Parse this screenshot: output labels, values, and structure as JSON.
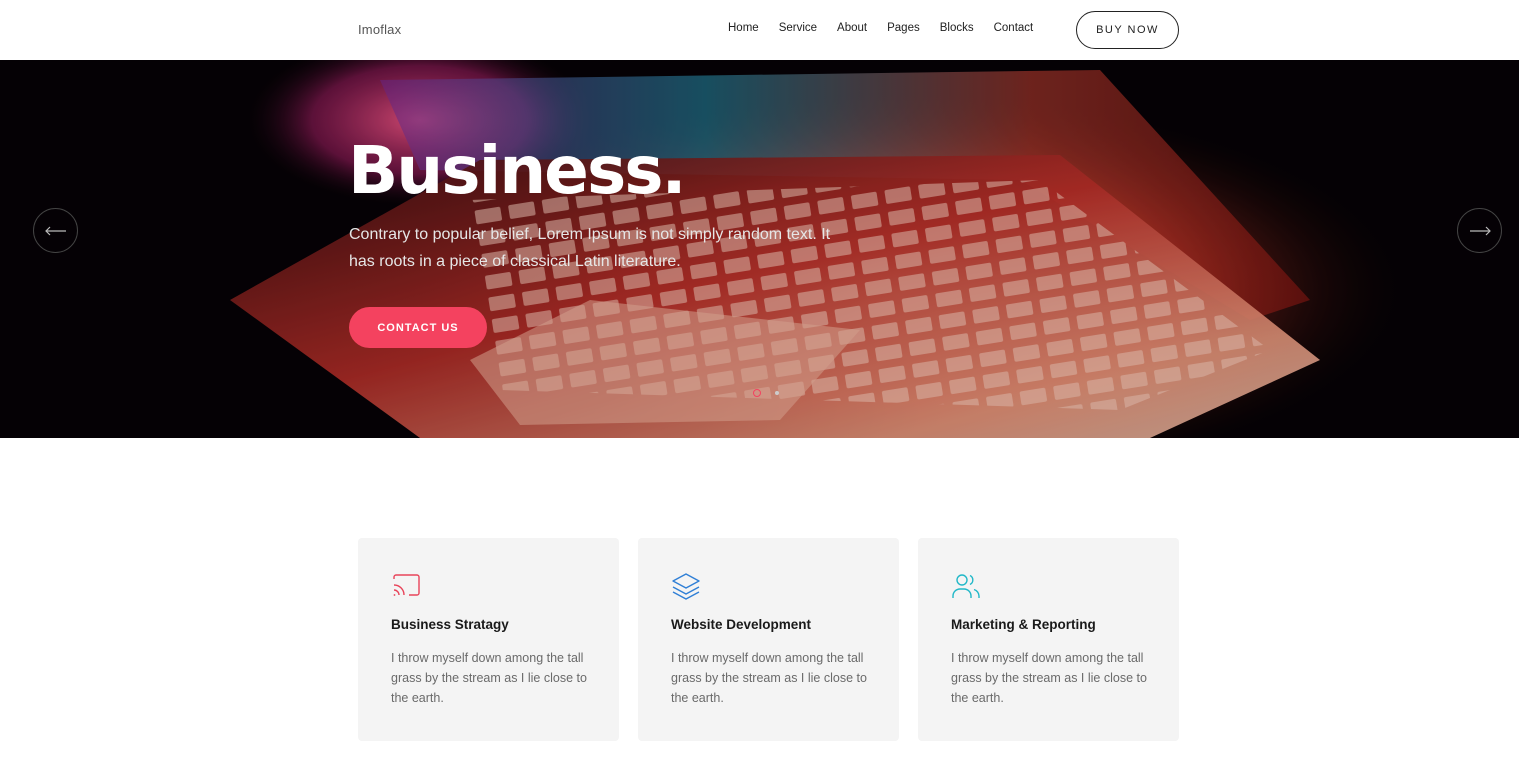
{
  "header": {
    "logo": "Imoflax",
    "nav": [
      "Home",
      "Service",
      "About",
      "Pages",
      "Blocks",
      "Contact"
    ],
    "buy_label": "BUY NOW"
  },
  "hero": {
    "title": "Business.",
    "text": "Contrary to popular belief, Lorem Ipsum is not simply random text. It has roots in a piece of classical Latin literature.",
    "cta_label": "CONTACT US",
    "prev_icon": "arrow-left-icon",
    "next_icon": "arrow-right-icon",
    "accent": "#f4425f",
    "slides": 2,
    "active_slide": 1
  },
  "features": [
    {
      "icon": "cast-icon",
      "color": "#e8445a",
      "title": "Business Stratagy",
      "text": "I throw myself down among the tall grass by the stream as I lie close to the earth."
    },
    {
      "icon": "layers-icon",
      "color": "#2f7fd6",
      "title": "Website Development",
      "text": "I throw myself down among the tall grass by the stream as I lie close to the earth."
    },
    {
      "icon": "users-icon",
      "color": "#22b8c8",
      "title": "Marketing & Reporting",
      "text": "I throw myself down among the tall grass by the stream as I lie close to the earth."
    }
  ]
}
